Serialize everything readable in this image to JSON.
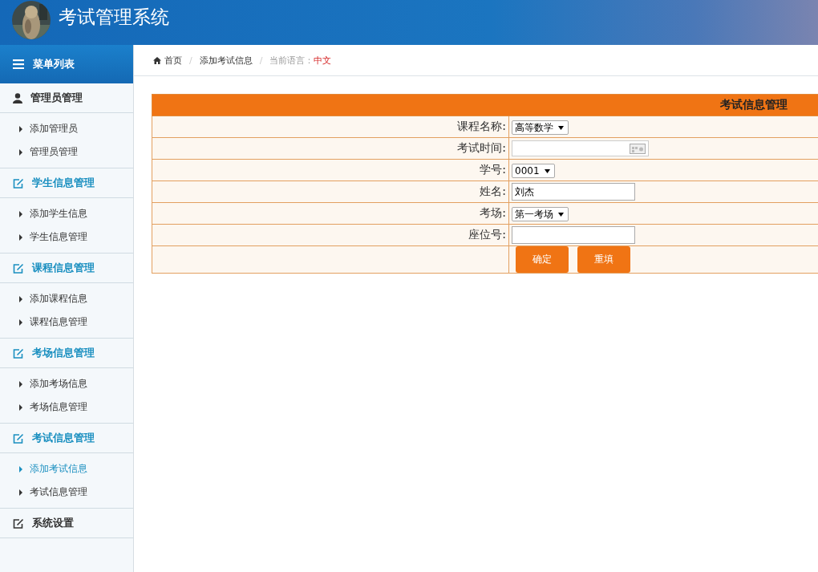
{
  "header": {
    "title": "考试管理系统"
  },
  "sidebar": {
    "title": "菜单列表",
    "groups": [
      {
        "label": "管理员管理",
        "kind": "user",
        "color": "#333333",
        "children": [
          {
            "label": "添加管理员",
            "selected": false
          },
          {
            "label": "管理员管理",
            "selected": false
          }
        ]
      },
      {
        "label": "学生信息管理",
        "kind": "edit",
        "color": "#1a8fc0",
        "children": [
          {
            "label": "添加学生信息",
            "selected": false
          },
          {
            "label": "学生信息管理",
            "selected": false
          }
        ]
      },
      {
        "label": "课程信息管理",
        "kind": "edit",
        "color": "#1a8fc0",
        "children": [
          {
            "label": "添加课程信息",
            "selected": false
          },
          {
            "label": "课程信息管理",
            "selected": false
          }
        ]
      },
      {
        "label": "考场信息管理",
        "kind": "edit",
        "color": "#1a8fc0",
        "children": [
          {
            "label": "添加考场信息",
            "selected": false
          },
          {
            "label": "考场信息管理",
            "selected": false
          }
        ]
      },
      {
        "label": "考试信息管理",
        "kind": "edit",
        "color": "#1a8fc0",
        "children": [
          {
            "label": "添加考试信息",
            "selected": true
          },
          {
            "label": "考试信息管理",
            "selected": false
          }
        ]
      },
      {
        "label": "系统设置",
        "kind": "edit",
        "color": "#333333"
      }
    ]
  },
  "breadcrumb": {
    "separators": [
      "/",
      "/"
    ],
    "home": "首页",
    "current": "添加考试信息",
    "language_label": "当前语言：",
    "language": "中文"
  },
  "form": {
    "title": "考试信息管理",
    "fields": [
      {
        "label": "课程名称:",
        "kind": "select",
        "value": "高等数学"
      },
      {
        "label": "考试时间:",
        "kind": "date"
      },
      {
        "label": "学号:",
        "kind": "select",
        "value": "0001"
      },
      {
        "label": "姓名:",
        "kind": "text",
        "value": "刘杰"
      },
      {
        "label": "考场:",
        "kind": "select",
        "value": "第一考场"
      },
      {
        "label": "座位号:",
        "kind": "text"
      }
    ],
    "buttons": [
      "确定",
      "重填"
    ]
  }
}
